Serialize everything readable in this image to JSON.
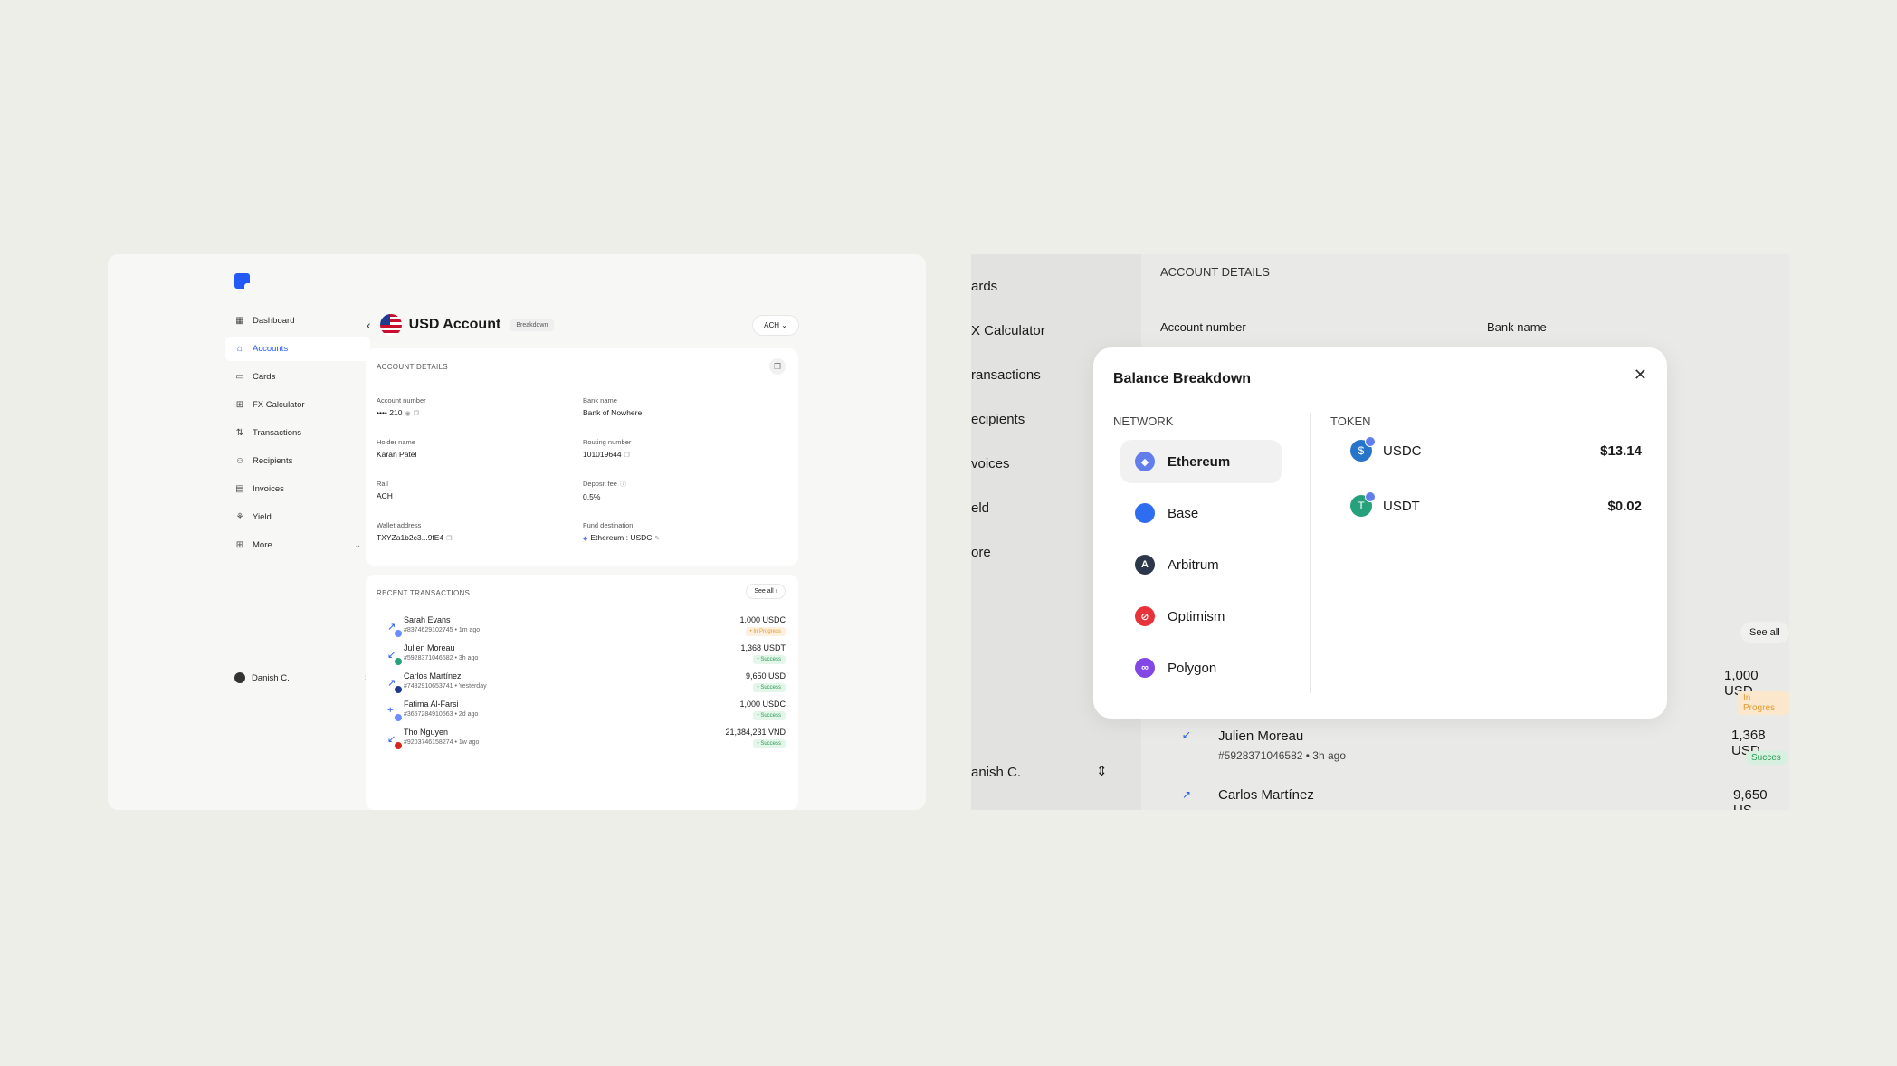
{
  "left": {
    "nav": [
      {
        "label": "Dashboard",
        "icon": "dashboard-icon"
      },
      {
        "label": "Accounts",
        "icon": "bank-icon",
        "active": true
      },
      {
        "label": "Cards",
        "icon": "card-icon"
      },
      {
        "label": "FX Calculator",
        "icon": "calculator-icon"
      },
      {
        "label": "Transactions",
        "icon": "transactions-icon"
      },
      {
        "label": "Recipients",
        "icon": "recipients-icon"
      },
      {
        "label": "Invoices",
        "icon": "invoice-icon"
      },
      {
        "label": "Yield",
        "icon": "yield-icon"
      },
      {
        "label": "More",
        "icon": "grid-icon"
      }
    ],
    "user": "Danish C.",
    "header": {
      "title": "USD Account",
      "breakdown": "Breakdown",
      "rail": "ACH"
    },
    "details": {
      "heading": "ACCOUNT DETAILS",
      "account_number": {
        "label": "Account number",
        "value": "•••• 210"
      },
      "bank_name": {
        "label": "Bank name",
        "value": "Bank of Nowhere"
      },
      "holder_name": {
        "label": "Holder name",
        "value": "Karan Patel"
      },
      "routing_number": {
        "label": "Routing number",
        "value": "101019644"
      },
      "rail": {
        "label": "Rail",
        "value": "ACH"
      },
      "deposit_fee": {
        "label": "Deposit fee",
        "value": "0.5%"
      },
      "wallet_address": {
        "label": "Wallet address",
        "value": "TXYZa1b2c3...9fE4"
      },
      "fund_destination": {
        "label": "Fund destination",
        "value": "Ethereum : USDC"
      }
    },
    "recent": {
      "heading": "RECENT TRANSACTIONS",
      "see_all": "See all",
      "rows": [
        {
          "name": "Sarah Evans",
          "meta": "#8374629102745 • 1m ago",
          "amount": "1,000 USDC",
          "status": "In Progress",
          "state": "prog"
        },
        {
          "name": "Julien Moreau",
          "meta": "#5928371046582 • 3h ago",
          "amount": "1,368 USDT",
          "status": "Success",
          "state": "ok"
        },
        {
          "name": "Carlos Martínez",
          "meta": "#7482910653741 • Yesterday",
          "amount": "9,650 USD",
          "status": "Success",
          "state": "ok"
        },
        {
          "name": "Fatima Al-Farsi",
          "meta": "#3657284910563 • 2d ago",
          "amount": "1,000 USDC",
          "status": "Success",
          "state": "ok"
        },
        {
          "name": "Tho Nguyen",
          "meta": "#9203746158274 • 1w ago",
          "amount": "21,384,231 VND",
          "status": "Success",
          "state": "ok"
        }
      ]
    }
  },
  "right": {
    "side_items": [
      "ards",
      "X Calculator",
      "ransactions",
      "ecipients",
      "voices",
      "eld",
      "ore"
    ],
    "user": "anish C.",
    "bg": {
      "heading": "ACCOUNT DETAILS",
      "account_number_label": "Account number",
      "bank_name_label": "Bank name",
      "see_all": "See all",
      "amt1": "1,000 USD",
      "status1": "In Progres",
      "name2": "Julien Moreau",
      "meta2": "#5928371046582 • 3h ago",
      "amt2": "1,368 USD",
      "status2": "Succes",
      "name3": "Carlos Martínez",
      "amt3": "9,650 US"
    },
    "modal": {
      "title": "Balance Breakdown",
      "network_label": "NETWORK",
      "token_label": "TOKEN",
      "networks": [
        {
          "label": "Ethereum",
          "color": "#627eea",
          "active": true
        },
        {
          "label": "Base",
          "color": "#2f6df0"
        },
        {
          "label": "Arbitrum",
          "color": "#2d374b"
        },
        {
          "label": "Optimism",
          "color": "#e8333b"
        },
        {
          "label": "Polygon",
          "color": "#8247e5"
        }
      ],
      "tokens": [
        {
          "label": "USDC",
          "value": "$13.14",
          "color": "#2775ca",
          "glyph": "$"
        },
        {
          "label": "USDT",
          "value": "$0.02",
          "color": "#26a17b",
          "glyph": "T"
        }
      ]
    }
  }
}
